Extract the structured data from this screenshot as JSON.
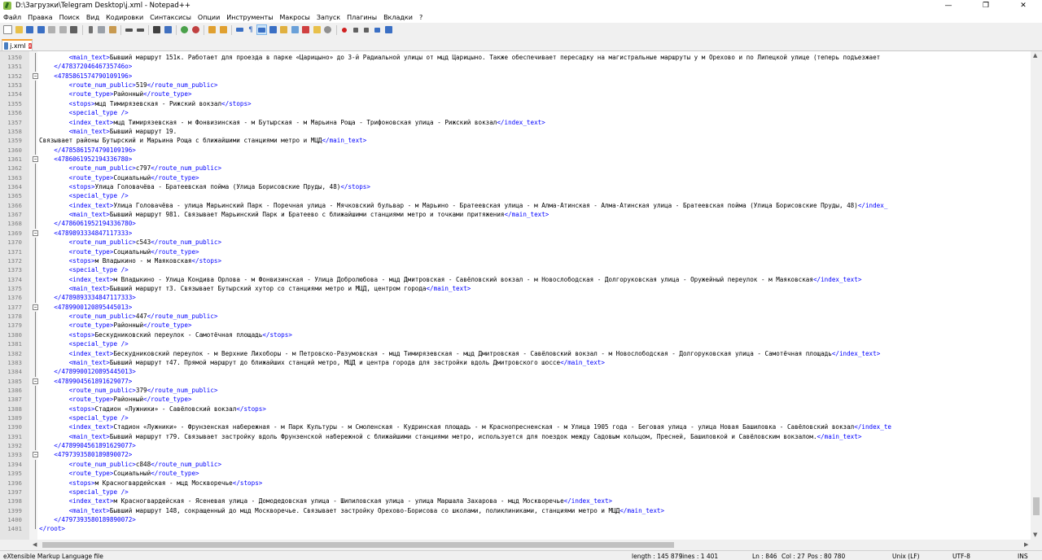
{
  "window": {
    "title": "D:\\Загрузки\\Telegram Desktop\\j.xml - Notepad++",
    "minimize": "—",
    "maximize": "❐",
    "close": "✕"
  },
  "menu": [
    "Файл",
    "Правка",
    "Поиск",
    "Вид",
    "Кодировки",
    "Синтаксисы",
    "Опции",
    "Инструменты",
    "Макросы",
    "Запуск",
    "Плагины",
    "Вкладки",
    "?"
  ],
  "tab": {
    "label": "j.xml",
    "close": "x"
  },
  "editor": {
    "lines": [
      {
        "n": "1350",
        "fold": "line",
        "segs": [
          [
            "t",
            "        "
          ],
          [
            "g",
            "<main_text>"
          ],
          [
            "t",
            "Бывший маршрут 151к. Работает для проезда в парке «Царицыно» до 3-й Радиальной улицы от мцд Царицыно. Также обеспечивает пересадку на магистральные маршруты у м Орехово и по Липецкой улице (теперь подъезжает"
          ]
        ]
      },
      {
        "n": "1351",
        "fold": "line",
        "segs": [
          [
            "t",
            "    "
          ],
          [
            "g",
            "</47837204646735746о>"
          ]
        ]
      },
      {
        "n": "1352",
        "fold": "box",
        "segs": [
          [
            "t",
            "    "
          ],
          [
            "g",
            "<4785861574790109196>"
          ]
        ]
      },
      {
        "n": "1353",
        "fold": "line",
        "segs": [
          [
            "t",
            "        "
          ],
          [
            "g",
            "<route_num_public>"
          ],
          [
            "t",
            "519"
          ],
          [
            "g",
            "</route_num_public>"
          ]
        ]
      },
      {
        "n": "1354",
        "fold": "line",
        "segs": [
          [
            "t",
            "        "
          ],
          [
            "g",
            "<route_type>"
          ],
          [
            "t",
            "Районный"
          ],
          [
            "g",
            "</route_type>"
          ]
        ]
      },
      {
        "n": "1355",
        "fold": "line",
        "segs": [
          [
            "t",
            "        "
          ],
          [
            "g",
            "<stops>"
          ],
          [
            "t",
            "мцд Тимирязевская - Рижский вокзал"
          ],
          [
            "g",
            "</stops>"
          ]
        ]
      },
      {
        "n": "1356",
        "fold": "line",
        "segs": [
          [
            "t",
            "        "
          ],
          [
            "g",
            "<special_type />"
          ]
        ]
      },
      {
        "n": "1357",
        "fold": "line",
        "segs": [
          [
            "t",
            "        "
          ],
          [
            "g",
            "<index_text>"
          ],
          [
            "t",
            "мцд Тимирязевская - м Фонвизинская - м Бутырская - м Марьина Роща - Трифоновская улица - Рижский вокзал"
          ],
          [
            "g",
            "</index_text>"
          ]
        ]
      },
      {
        "n": "1358",
        "fold": "line",
        "segs": [
          [
            "t",
            "        "
          ],
          [
            "g",
            "<main_text>"
          ],
          [
            "t",
            "Бывший маршрут 19."
          ]
        ]
      },
      {
        "n": "1359",
        "fold": "line",
        "segs": [
          [
            "t",
            "Связывает районы Бутырский и Марьина Роща с ближайшими станциями метро и МЦД"
          ],
          [
            "g",
            "</main_text>"
          ]
        ]
      },
      {
        "n": "1360",
        "fold": "line",
        "segs": [
          [
            "t",
            "    "
          ],
          [
            "g",
            "</4785861574790109196>"
          ]
        ]
      },
      {
        "n": "1361",
        "fold": "box",
        "segs": [
          [
            "t",
            "    "
          ],
          [
            "g",
            "<4786061952194336780>"
          ]
        ]
      },
      {
        "n": "1362",
        "fold": "line",
        "segs": [
          [
            "t",
            "        "
          ],
          [
            "g",
            "<route_num_public>"
          ],
          [
            "t",
            "с797"
          ],
          [
            "g",
            "</route_num_public>"
          ]
        ]
      },
      {
        "n": "1363",
        "fold": "line",
        "segs": [
          [
            "t",
            "        "
          ],
          [
            "g",
            "<route_type>"
          ],
          [
            "t",
            "Социальный"
          ],
          [
            "g",
            "</route_type>"
          ]
        ]
      },
      {
        "n": "1364",
        "fold": "line",
        "segs": [
          [
            "t",
            "        "
          ],
          [
            "g",
            "<stops>"
          ],
          [
            "t",
            "Улица Головачёва - Братеевская пойма (Улица Борисовские Пруды, 48)"
          ],
          [
            "g",
            "</stops>"
          ]
        ]
      },
      {
        "n": "1365",
        "fold": "line",
        "segs": [
          [
            "t",
            "        "
          ],
          [
            "g",
            "<special_type />"
          ]
        ]
      },
      {
        "n": "1366",
        "fold": "line",
        "segs": [
          [
            "t",
            "        "
          ],
          [
            "g",
            "<index_text>"
          ],
          [
            "t",
            "Улица Головачёва - улица Марьинский Парк - Поречная улица - Мячковский бульвар - м Марьино - Братеевская улица - м Алма-Атинская - Алма-Атинская улица - Братеевская пойма (Улица Борисовские Пруды, 48)"
          ],
          [
            "g",
            "</index_"
          ]
        ]
      },
      {
        "n": "1367",
        "fold": "line",
        "segs": [
          [
            "t",
            "        "
          ],
          [
            "g",
            "<main_text>"
          ],
          [
            "t",
            "Бывший маршрут 981. Связывает Марьинский Парк и Братеево с ближайшими станциями метро и точками притяжения"
          ],
          [
            "g",
            "</main_text>"
          ]
        ]
      },
      {
        "n": "1368",
        "fold": "line",
        "segs": [
          [
            "t",
            "    "
          ],
          [
            "g",
            "</4786061952194336780>"
          ]
        ]
      },
      {
        "n": "1369",
        "fold": "box",
        "segs": [
          [
            "t",
            "    "
          ],
          [
            "g",
            "<4789893334847117333>"
          ]
        ]
      },
      {
        "n": "1370",
        "fold": "line",
        "segs": [
          [
            "t",
            "        "
          ],
          [
            "g",
            "<route_num_public>"
          ],
          [
            "t",
            "с543"
          ],
          [
            "g",
            "</route_num_public>"
          ]
        ]
      },
      {
        "n": "1371",
        "fold": "line",
        "segs": [
          [
            "t",
            "        "
          ],
          [
            "g",
            "<route_type>"
          ],
          [
            "t",
            "Социальный"
          ],
          [
            "g",
            "</route_type>"
          ]
        ]
      },
      {
        "n": "1372",
        "fold": "line",
        "segs": [
          [
            "t",
            "        "
          ],
          [
            "g",
            "<stops>"
          ],
          [
            "t",
            "м Владыкино - м Маяковская"
          ],
          [
            "g",
            "</stops>"
          ]
        ]
      },
      {
        "n": "1373",
        "fold": "line",
        "segs": [
          [
            "t",
            "        "
          ],
          [
            "g",
            "<special_type />"
          ]
        ]
      },
      {
        "n": "1374",
        "fold": "line",
        "segs": [
          [
            "t",
            "        "
          ],
          [
            "g",
            "<index_text>"
          ],
          [
            "t",
            "м Владыкино - Улица Кондива Орлова - м Фонвизинская - Улица Добролюбова - мцд Дмитровская - Савёловский вокзал - м Новослободская - Долгоруковская улица - Оружейный переулок - м Маяковская"
          ],
          [
            "g",
            "</index_text>"
          ]
        ]
      },
      {
        "n": "1375",
        "fold": "line",
        "segs": [
          [
            "t",
            "        "
          ],
          [
            "g",
            "<main_text>"
          ],
          [
            "t",
            "Бывший маршрут т3. Связывает Бутырский хутор со станциями метро и МЦД, центром города"
          ],
          [
            "g",
            "</main_text>"
          ]
        ]
      },
      {
        "n": "1376",
        "fold": "line",
        "segs": [
          [
            "t",
            "    "
          ],
          [
            "g",
            "</4789893334847117333>"
          ]
        ]
      },
      {
        "n": "1377",
        "fold": "box",
        "segs": [
          [
            "t",
            "    "
          ],
          [
            "g",
            "<4789900120895445013>"
          ]
        ]
      },
      {
        "n": "1378",
        "fold": "line",
        "segs": [
          [
            "t",
            "        "
          ],
          [
            "g",
            "<route_num_public>"
          ],
          [
            "t",
            "447"
          ],
          [
            "g",
            "</route_num_public>"
          ]
        ]
      },
      {
        "n": "1379",
        "fold": "line",
        "segs": [
          [
            "t",
            "        "
          ],
          [
            "g",
            "<route_type>"
          ],
          [
            "t",
            "Районный"
          ],
          [
            "g",
            "</route_type>"
          ]
        ]
      },
      {
        "n": "1380",
        "fold": "line",
        "segs": [
          [
            "t",
            "        "
          ],
          [
            "g",
            "<stops>"
          ],
          [
            "t",
            "Бескудниковский переулок - Самотёчная площадь"
          ],
          [
            "g",
            "</stops>"
          ]
        ]
      },
      {
        "n": "1381",
        "fold": "line",
        "segs": [
          [
            "t",
            "        "
          ],
          [
            "g",
            "<special_type />"
          ]
        ]
      },
      {
        "n": "1382",
        "fold": "line",
        "segs": [
          [
            "t",
            "        "
          ],
          [
            "g",
            "<index_text>"
          ],
          [
            "t",
            "Бескудниковский переулок - м Верхние Лихоборы - м Петровско-Разумовская - мцд Тимирязевская - мцд Дмитровская - Савёловский вокзал - м Новослободская - Долгоруковская улица - Самотёчная площадь"
          ],
          [
            "g",
            "</index_text>"
          ]
        ]
      },
      {
        "n": "1383",
        "fold": "line",
        "segs": [
          [
            "t",
            "        "
          ],
          [
            "g",
            "<main_text>"
          ],
          [
            "t",
            "Бывший маршрут т47. Прямой маршрут до ближайших станций метро, МЦД и центра города для застройки вдоль Дмитровского шоссе"
          ],
          [
            "g",
            "</main_text>"
          ]
        ]
      },
      {
        "n": "1384",
        "fold": "line",
        "segs": [
          [
            "t",
            "    "
          ],
          [
            "g",
            "</4789900120895445013>"
          ]
        ]
      },
      {
        "n": "1385",
        "fold": "box",
        "segs": [
          [
            "t",
            "    "
          ],
          [
            "g",
            "<4789904561891629077>"
          ]
        ]
      },
      {
        "n": "1386",
        "fold": "line",
        "segs": [
          [
            "t",
            "        "
          ],
          [
            "g",
            "<route_num_public>"
          ],
          [
            "t",
            "379"
          ],
          [
            "g",
            "</route_num_public>"
          ]
        ]
      },
      {
        "n": "1387",
        "fold": "line",
        "segs": [
          [
            "t",
            "        "
          ],
          [
            "g",
            "<route_type>"
          ],
          [
            "t",
            "Районный"
          ],
          [
            "g",
            "</route_type>"
          ]
        ]
      },
      {
        "n": "1388",
        "fold": "line",
        "segs": [
          [
            "t",
            "        "
          ],
          [
            "g",
            "<stops>"
          ],
          [
            "t",
            "Стадион «Лужники» - Савёловский вокзал"
          ],
          [
            "g",
            "</stops>"
          ]
        ]
      },
      {
        "n": "1389",
        "fold": "line",
        "segs": [
          [
            "t",
            "        "
          ],
          [
            "g",
            "<special_type />"
          ]
        ]
      },
      {
        "n": "1390",
        "fold": "line",
        "segs": [
          [
            "t",
            "        "
          ],
          [
            "g",
            "<index_text>"
          ],
          [
            "t",
            "Стадион «Лужники» - Фрунзенская набережная - м Парк Культуры - м Смоленская - Кудринская площадь - м Краснопресненская - м Улица 1905 года - Беговая улица - улица Новая Башиловка - Савёловский вокзал"
          ],
          [
            "g",
            "</index_te"
          ]
        ]
      },
      {
        "n": "1391",
        "fold": "line",
        "segs": [
          [
            "t",
            "        "
          ],
          [
            "g",
            "<main_text>"
          ],
          [
            "t",
            "Бывший маршрут т79. Связывает застройку вдоль Фрунзенской набережной с ближайшими станциями метро, используется для поездок между Садовым кольцом, Пресней, Башиловкой и Савёловским вокзалом."
          ],
          [
            "g",
            "</main_text>"
          ]
        ]
      },
      {
        "n": "1392",
        "fold": "line",
        "segs": [
          [
            "t",
            "    "
          ],
          [
            "g",
            "</4789904561891629077>"
          ]
        ]
      },
      {
        "n": "1393",
        "fold": "box",
        "segs": [
          [
            "t",
            "    "
          ],
          [
            "g",
            "<4797393580189890072>"
          ]
        ]
      },
      {
        "n": "1394",
        "fold": "line",
        "segs": [
          [
            "t",
            "        "
          ],
          [
            "g",
            "<route_num_public>"
          ],
          [
            "t",
            "с848"
          ],
          [
            "g",
            "</route_num_public>"
          ]
        ]
      },
      {
        "n": "1395",
        "fold": "line",
        "segs": [
          [
            "t",
            "        "
          ],
          [
            "g",
            "<route_type>"
          ],
          [
            "t",
            "Социальный"
          ],
          [
            "g",
            "</route_type>"
          ]
        ]
      },
      {
        "n": "1396",
        "fold": "line",
        "segs": [
          [
            "t",
            "        "
          ],
          [
            "g",
            "<stops>"
          ],
          [
            "t",
            "м Красногвардейская - мцд Москворечье"
          ],
          [
            "g",
            "</stops>"
          ]
        ]
      },
      {
        "n": "1397",
        "fold": "line",
        "segs": [
          [
            "t",
            "        "
          ],
          [
            "g",
            "<special_type />"
          ]
        ]
      },
      {
        "n": "1398",
        "fold": "line",
        "segs": [
          [
            "t",
            "        "
          ],
          [
            "g",
            "<index_text>"
          ],
          [
            "t",
            "м Красногвардейская - Ясеневая улица - Домодедовская улица - Шипиловская улица - улица Маршала Захарова - мцд Москворечье"
          ],
          [
            "g",
            "</index_text>"
          ]
        ]
      },
      {
        "n": "1399",
        "fold": "line",
        "segs": [
          [
            "t",
            "        "
          ],
          [
            "g",
            "<main_text>"
          ],
          [
            "t",
            "Бывший маршрут 148, сокращенный до мцд Москворечье. Связывает застройку Орехово-Борисова со школами, поликлиниками, станциями метро и МЦД"
          ],
          [
            "g",
            "</main_text>"
          ]
        ]
      },
      {
        "n": "1400",
        "fold": "line",
        "segs": [
          [
            "t",
            "    "
          ],
          [
            "g",
            "</4797393580189890072>"
          ]
        ]
      },
      {
        "n": "1401",
        "fold": "end",
        "segs": [
          [
            "g",
            "</root>"
          ]
        ]
      }
    ]
  },
  "status": {
    "filetype": "eXtensible Markup Language file",
    "length": "length : 145 879",
    "lines": "lines : 1 401",
    "ln": "Ln : 846",
    "col": "Col : 27",
    "pos": "Pos : 80 780",
    "eol": "Unix (LF)",
    "encoding": "UTF-8",
    "mode": "INS"
  },
  "colors": {
    "tag": "#0000ff",
    "text": "#000000",
    "tab_accent": "#f4a030"
  }
}
